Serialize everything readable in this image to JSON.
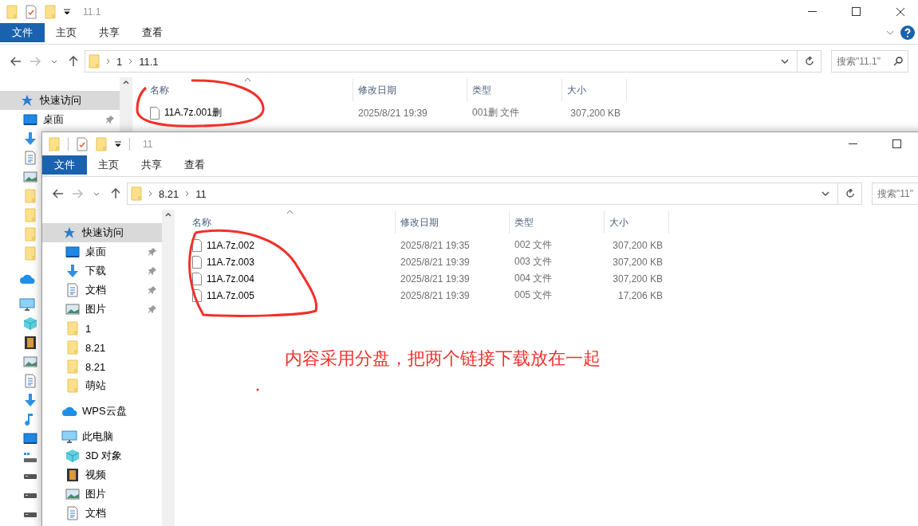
{
  "windows": [
    {
      "title": "11.1",
      "tabs": [
        {
          "label": "文件",
          "kind": "file"
        },
        {
          "label": "主页",
          "kind": "tab"
        },
        {
          "label": "共享",
          "kind": "tab"
        },
        {
          "label": "查看",
          "kind": "tab"
        }
      ],
      "path": [
        "1",
        "11.1"
      ],
      "search": {
        "placeholder": "搜索\"11.1\""
      },
      "sidebar": [
        {
          "kind": "star",
          "label": "快速访问",
          "selected": true,
          "children": [
            {
              "kind": "desktop",
              "label": "桌面",
              "pinned": true,
              "selected": false
            },
            {
              "kind": "download",
              "selected": false
            },
            {
              "kind": "document",
              "selected": false
            },
            {
              "kind": "picture",
              "selected": false
            },
            {
              "kind": "folder",
              "selected": false
            },
            {
              "kind": "folder",
              "selected": false
            },
            {
              "kind": "folder",
              "selected": false
            },
            {
              "kind": "folder",
              "selected": false
            }
          ]
        },
        {
          "kind": "cloud",
          "selected": false
        },
        {
          "kind": "pc",
          "selected": false,
          "children": [
            {
              "kind": "cube",
              "selected": false
            },
            {
              "kind": "film",
              "selected": false
            },
            {
              "kind": "picture",
              "selected": false
            },
            {
              "kind": "document",
              "selected": false
            },
            {
              "kind": "download",
              "selected": false
            },
            {
              "kind": "music",
              "selected": false
            },
            {
              "kind": "desktop",
              "selected": false
            },
            {
              "kind": "netdrive",
              "selected": false
            },
            {
              "kind": "drive",
              "selected": false
            },
            {
              "kind": "drive",
              "selected": false
            },
            {
              "kind": "drive",
              "selected": false
            }
          ]
        }
      ],
      "columns": [
        "名称",
        "修改日期",
        "类型",
        "大小"
      ],
      "rows": [
        {
          "name": "11A.7z.001删",
          "date": "2025/8/21 19:39",
          "type": "001删 文件",
          "size": "307,200 KB"
        }
      ]
    },
    {
      "title": "11",
      "tabs": [
        {
          "label": "文件",
          "kind": "file"
        },
        {
          "label": "主页",
          "kind": "tab"
        },
        {
          "label": "共享",
          "kind": "tab"
        },
        {
          "label": "查看",
          "kind": "tab"
        }
      ],
      "path": [
        "8.21",
        "11"
      ],
      "search": {
        "placeholder": "搜索\"11\""
      },
      "sidebar": [
        {
          "kind": "star",
          "label": "快速访问",
          "selected": true,
          "children": [
            {
              "kind": "desktop",
              "label": "桌面",
              "pinned": true,
              "selected": false
            },
            {
              "kind": "download",
              "label": "下载",
              "pinned": true,
              "selected": false
            },
            {
              "kind": "document",
              "label": "文档",
              "pinned": true,
              "selected": false
            },
            {
              "kind": "picture",
              "label": "图片",
              "pinned": true,
              "selected": false
            },
            {
              "kind": "folder",
              "label": "1",
              "pinned": false,
              "selected": false
            },
            {
              "kind": "folder",
              "label": "8.21",
              "pinned": false,
              "selected": false
            },
            {
              "kind": "folder",
              "label": "8.21",
              "pinned": false,
              "selected": false
            },
            {
              "kind": "folder",
              "label": "萌站",
              "pinned": false,
              "selected": false
            }
          ]
        },
        {
          "kind": "cloud",
          "label": "WPS云盘",
          "selected": false
        },
        {
          "kind": "pc",
          "label": "此电脑",
          "selected": false,
          "children": [
            {
              "kind": "cube",
              "label": "3D 对象",
              "pinned": false,
              "selected": false
            },
            {
              "kind": "film",
              "label": "视频",
              "pinned": false,
              "selected": false
            },
            {
              "kind": "picture",
              "label": "图片",
              "pinned": false,
              "selected": false
            },
            {
              "kind": "document",
              "label": "文档",
              "pinned": false,
              "selected": false
            }
          ]
        }
      ],
      "columns": [
        "名称",
        "修改日期",
        "类型",
        "大小"
      ],
      "rows": [
        {
          "name": "11A.7z.002",
          "date": "2025/8/21 19:35",
          "type": "002 文件",
          "size": "307,200 KB"
        },
        {
          "name": "11A.7z.003",
          "date": "2025/8/21 19:39",
          "type": "003 文件",
          "size": "307,200 KB"
        },
        {
          "name": "11A.7z.004",
          "date": "2025/8/21 19:39",
          "type": "004 文件",
          "size": "307,200 KB"
        },
        {
          "name": "11A.7z.005",
          "date": "2025/8/21 19:39",
          "type": "005 文件",
          "size": "17,206 KB"
        }
      ]
    }
  ],
  "annotation": {
    "text": "内容采用分盘，把两个链接下载放在一起"
  }
}
